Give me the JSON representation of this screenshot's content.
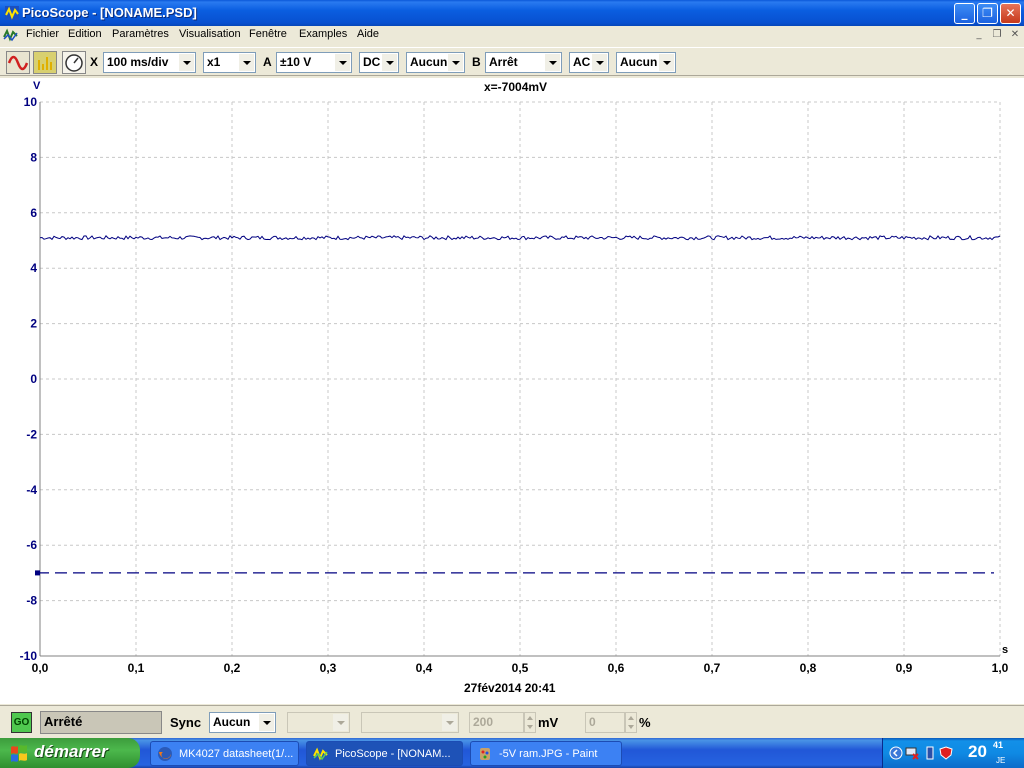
{
  "window": {
    "title": "PicoScope - [NONAME.PSD]",
    "minimize": "_",
    "maximize": "❐",
    "close": "✕"
  },
  "menu": {
    "items": [
      "Fichier",
      "Edition",
      "Paramètres",
      "Visualisation",
      "Fenêtre",
      "Examples",
      "Aide"
    ]
  },
  "toolbar": {
    "x_label": "X",
    "timebase": "100 ms/div",
    "multiplier": "x1",
    "channel_a_label": "A",
    "channel_a_range": "±10 V",
    "channel_a_coupling": "DC",
    "channel_a_filter": "Aucun",
    "channel_b_label": "B",
    "channel_b_range": "Arrêt",
    "channel_b_coupling": "AC",
    "channel_b_filter": "Aucun"
  },
  "plot": {
    "readout": "x=-7004mV",
    "timestamp": "27fév2014  20:41",
    "y_unit": "V",
    "x_unit": "s"
  },
  "chart_data": {
    "type": "line",
    "xlabel": "s",
    "ylabel": "V",
    "xlim": [
      0,
      1
    ],
    "ylim": [
      -10,
      10
    ],
    "x_ticks": [
      "0,0",
      "0,1",
      "0,2",
      "0,3",
      "0,4",
      "0,5",
      "0,6",
      "0,7",
      "0,8",
      "0,9",
      "1,0"
    ],
    "y_ticks": [
      "10",
      "8",
      "6",
      "4",
      "2",
      "0",
      "-2",
      "-4",
      "-6",
      "-8",
      "-10"
    ],
    "grid": true,
    "series": [
      {
        "level": 5.1,
        "color": "#000080",
        "style": "noisy"
      },
      {
        "level": -7.0,
        "color": "#000080",
        "style": "dashed"
      }
    ]
  },
  "status": {
    "go_label": "GO",
    "state": "Arrêté",
    "sync_label": "Sync",
    "sync_value": "Aucun",
    "level_value": "200",
    "level_unit": "mV",
    "percent_value": "0",
    "percent_unit": "%"
  },
  "taskbar": {
    "start_label": "démarrer",
    "tasks": [
      "MK4027 datasheet(1/...",
      "PicoScope - [NONAM...",
      "-5V ram.JPG - Paint"
    ],
    "clock_hour": "20",
    "clock_minute": "41",
    "clock_lang": "JE"
  }
}
